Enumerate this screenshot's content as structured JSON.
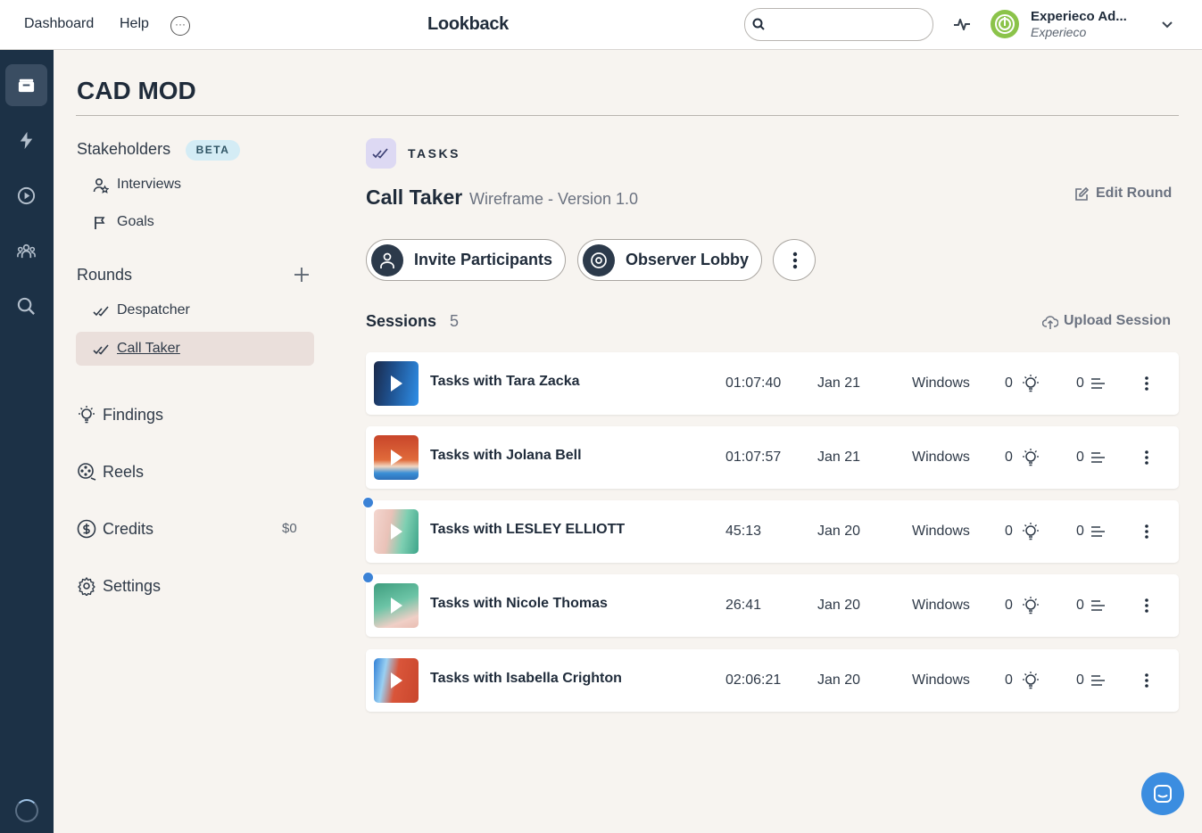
{
  "topbar": {
    "dashboard": "Dashboard",
    "help": "Help",
    "more": "···",
    "logo": "Lookback",
    "search_value": "",
    "user_name": "Experieco Ad...",
    "org_name": "Experieco"
  },
  "page": {
    "title": "CAD MOD"
  },
  "sidebar": {
    "stakeholders": "Stakeholders",
    "beta": "BETA",
    "interviews": "Interviews",
    "goals": "Goals",
    "rounds": "Rounds",
    "round_items": [
      "Despatcher",
      "Call Taker"
    ],
    "findings": "Findings",
    "reels": "Reels",
    "credits": "Credits",
    "credits_value": "$0",
    "settings": "Settings"
  },
  "round": {
    "kind": "TASKS",
    "title": "Call Taker",
    "subtitle": "Wireframe - Version 1.0",
    "edit": "Edit Round",
    "invite": "Invite Participants",
    "lobby": "Observer Lobby"
  },
  "sessions": {
    "label": "Sessions",
    "count": "5",
    "upload": "Upload Session",
    "rows": [
      {
        "name": "Tasks with Tara Zacka",
        "duration": "01:07:40",
        "date": "Jan 21",
        "os": "Windows",
        "insights": "0",
        "notes": "0",
        "new": false
      },
      {
        "name": "Tasks with Jolana Bell",
        "duration": "01:07:57",
        "date": "Jan 21",
        "os": "Windows",
        "insights": "0",
        "notes": "0",
        "new": false
      },
      {
        "name": "Tasks with LESLEY ELLIOTT",
        "duration": "45:13",
        "date": "Jan 20",
        "os": "Windows",
        "insights": "0",
        "notes": "0",
        "new": true
      },
      {
        "name": "Tasks with Nicole Thomas",
        "duration": "26:41",
        "date": "Jan 20",
        "os": "Windows",
        "insights": "0",
        "notes": "0",
        "new": true
      },
      {
        "name": "Tasks with Isabella Crighton",
        "duration": "02:06:21",
        "date": "Jan 20",
        "os": "Windows",
        "insights": "0",
        "notes": "0",
        "new": false
      }
    ]
  },
  "colors": {
    "rail": "#1c3146",
    "accent_blue": "#3b8de0",
    "beta_bg": "#d4ecf5",
    "active_round_bg": "#eadfdb"
  },
  "icons": {
    "rail": [
      "archive-icon",
      "lightning-icon",
      "play-circle-icon",
      "people-icon",
      "search-icon"
    ],
    "sidebar": [
      "interviews-icon",
      "flag-icon",
      "double-check-icon",
      "lightbulb-icon",
      "reels-icon",
      "dollar-icon",
      "gear-icon"
    ]
  }
}
